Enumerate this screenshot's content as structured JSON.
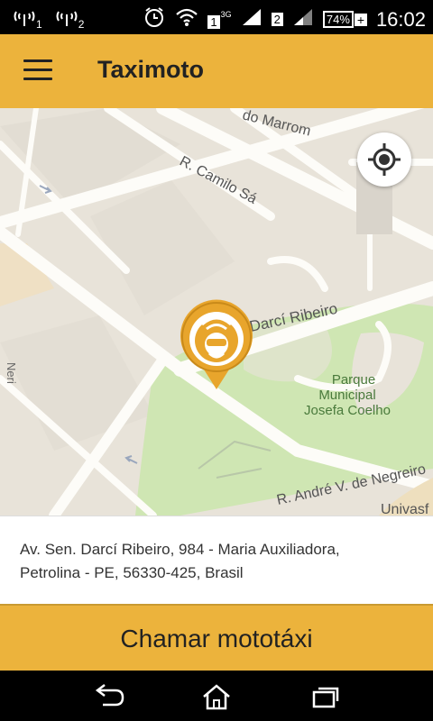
{
  "status_bar": {
    "sim1": "1",
    "sim2": "2",
    "network_type": "3G",
    "battery": "74%",
    "time": "16:02"
  },
  "app_bar": {
    "title": "Taximoto"
  },
  "map": {
    "street_labels": {
      "do_marrom": "do Marrom",
      "camilo_sa": "R. Camilo Sá",
      "darci_ribeiro": "Darcí Ribeiro",
      "park_line1": "Parque",
      "park_line2": "Municipal",
      "park_line3": "Josefa Coelho",
      "andre_negreiros": "R. André V. de Negreiro",
      "univasf": "Univasf",
      "left_vertical": "Neri"
    }
  },
  "address": {
    "line1": "Av. Sen. Darcí Ribeiro, 984 - Maria Auxiliadora,",
    "line2": "Petrolina - PE, 56330-425, Brasil"
  },
  "actions": {
    "call_label": "Chamar mototáxi"
  },
  "colors": {
    "brand": "#ecb33c",
    "park": "#cfe6b3",
    "map_bg": "#e8e3d9"
  }
}
